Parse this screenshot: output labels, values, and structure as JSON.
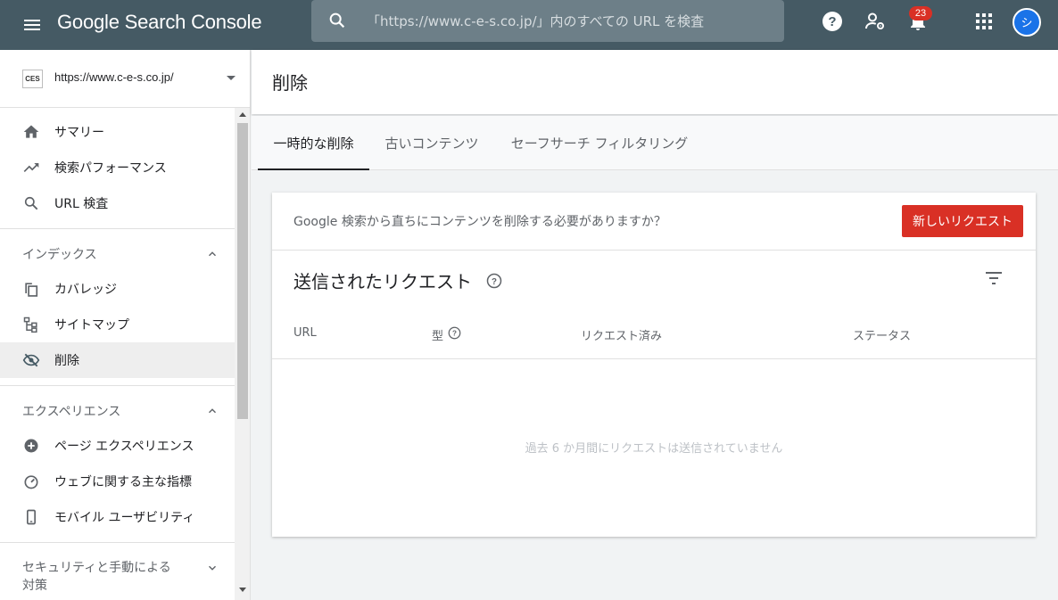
{
  "header": {
    "brand": "Google Search Console",
    "search_placeholder": "「https://www.c-e-s.co.jp/」内のすべての URL を検査",
    "notification_count": "23",
    "avatar_initial": "シ"
  },
  "property": {
    "logo_text": "CES",
    "url": "https://www.c-e-s.co.jp/"
  },
  "sidebar": {
    "top_items": [
      {
        "label": "サマリー",
        "icon": "home-icon"
      },
      {
        "label": "検索パフォーマンス",
        "icon": "trending-up-icon"
      },
      {
        "label": "URL 検査",
        "icon": "search-icon"
      }
    ],
    "sections": [
      {
        "title": "インデックス",
        "items": [
          {
            "label": "カバレッジ",
            "icon": "copy-icon"
          },
          {
            "label": "サイトマップ",
            "icon": "sitemap-icon"
          },
          {
            "label": "削除",
            "icon": "eye-off-icon",
            "active": true
          }
        ]
      },
      {
        "title": "エクスペリエンス",
        "items": [
          {
            "label": "ページ エクスペリエンス",
            "icon": "plus-circle-icon"
          },
          {
            "label": "ウェブに関する主な指標",
            "icon": "speedometer-icon"
          },
          {
            "label": "モバイル ユーザビリティ",
            "icon": "phone-icon"
          }
        ]
      },
      {
        "title": "セキュリティと手動による対策",
        "title_line1": "セキュリティと手動による",
        "title_line2": "対策"
      }
    ]
  },
  "main": {
    "page_title": "削除",
    "tabs": [
      {
        "label": "一時的な削除",
        "active": true
      },
      {
        "label": "古いコンテンツ"
      },
      {
        "label": "セーフサーチ フィルタリング"
      }
    ],
    "card": {
      "banner_text": "Google 検索から直ちにコンテンツを削除する必要がありますか？",
      "new_request_label": "新しいリクエスト",
      "title": "送信されたリクエスト",
      "columns": [
        "URL",
        "型",
        "リクエスト済み",
        "ステータス"
      ],
      "empty_message": "過去 6 か月間にリクエストは送信されていません"
    }
  },
  "colors": {
    "header_bg": "#455a64",
    "accent_red": "#d93025",
    "avatar_blue": "#1a73e8"
  }
}
